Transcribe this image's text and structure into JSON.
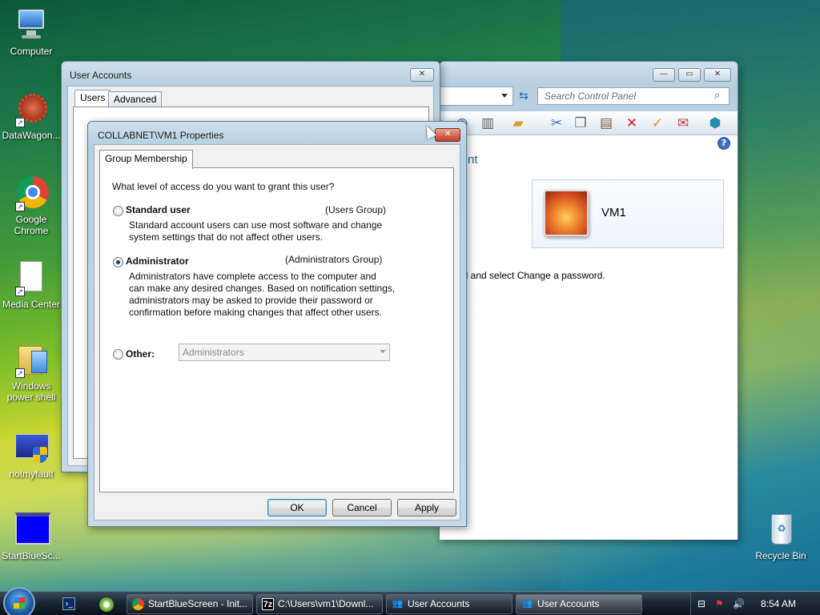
{
  "desktop": {
    "icons": [
      {
        "label": "Computer",
        "icon": "computer-icon"
      },
      {
        "label": "DataWagon...",
        "icon": "datawagon-icon"
      },
      {
        "label": "Google Chrome",
        "icon": "chrome-icon"
      },
      {
        "label": "Media Center",
        "icon": "file-icon"
      },
      {
        "label": "Windows power shell",
        "icon": "folder-icon"
      },
      {
        "label": "notmyfault",
        "icon": "notmyfault-icon"
      },
      {
        "label": "StartBlueSc...",
        "icon": "blue-window-icon"
      },
      {
        "label": "Recycle Bin",
        "icon": "recycle-bin-icon"
      }
    ]
  },
  "control_panel": {
    "search_placeholder": "Search Control Panel",
    "heading_fragment": "nt",
    "user_name": "VM1",
    "instruction_fragment": "el and select Change a password."
  },
  "user_accounts": {
    "title": "User Accounts",
    "tabs": [
      "Users",
      "Advanced"
    ]
  },
  "properties": {
    "title": "COLLABNET\\VM1 Properties",
    "tab": "Group Membership",
    "question": "What level of access do you want to grant this user?",
    "standard": {
      "label": "Standard user",
      "group": "(Users Group)",
      "desc1": "Standard account users can use most software and change",
      "desc2": "system settings that do not affect other users."
    },
    "admin": {
      "label": "Administrator",
      "group": "(Administrators Group)",
      "desc1": "Administrators have complete access to the computer and",
      "desc2": "can make any desired changes. Based on notification settings,",
      "desc3": "administrators may be asked to provide their password or",
      "desc4": "confirmation before making changes that affect other users."
    },
    "other": {
      "label": "Other:",
      "value": "Administrators"
    },
    "selected": "Administrator",
    "buttons": {
      "ok": "OK",
      "cancel": "Cancel",
      "apply": "Apply"
    }
  },
  "taskbar": {
    "buttons": [
      {
        "label": "StartBlueScreen - Init...",
        "icon": "chrome-icon"
      },
      {
        "label": "C:\\Users\\vm1\\Downl...",
        "icon": "7zip-icon"
      },
      {
        "label": "User Accounts",
        "icon": "users-icon"
      },
      {
        "label": "User Accounts",
        "icon": "users-icon"
      }
    ],
    "clock": "8:54 AM"
  },
  "colors": {
    "accent": "#1d5da8",
    "close_red": "#c23b22"
  }
}
